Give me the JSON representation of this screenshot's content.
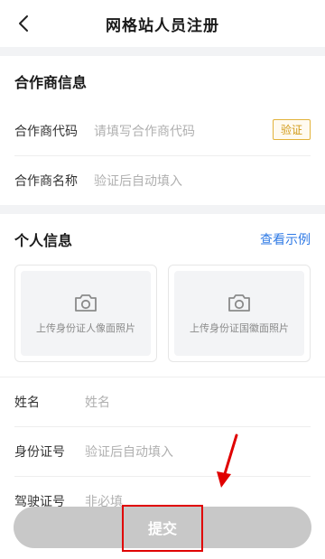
{
  "header": {
    "title": "网格站人员注册",
    "back_icon": "chevron-left-icon"
  },
  "partner": {
    "section_title": "合作商信息",
    "code_label": "合作商代码",
    "code_placeholder": "请填写合作商代码",
    "verify_label": "验证",
    "name_label": "合作商名称",
    "name_value": "验证后自动填入"
  },
  "personal": {
    "section_title": "个人信息",
    "example_link": "查看示例",
    "upload_front": "上传身份证人像面照片",
    "upload_back": "上传身份证国徽面照片",
    "camera_icon": "camera-icon",
    "fields": [
      {
        "label": "姓名",
        "value": "姓名"
      },
      {
        "label": "身份证号",
        "value": "验证后自动填入"
      },
      {
        "label": "驾驶证号",
        "value": "非必填"
      }
    ]
  },
  "footer": {
    "submit_label": "提交"
  },
  "colors": {
    "link": "#2f7ae5",
    "verify": "#d19a17",
    "annotation": "#e00000",
    "button": "#c8c8c8"
  }
}
